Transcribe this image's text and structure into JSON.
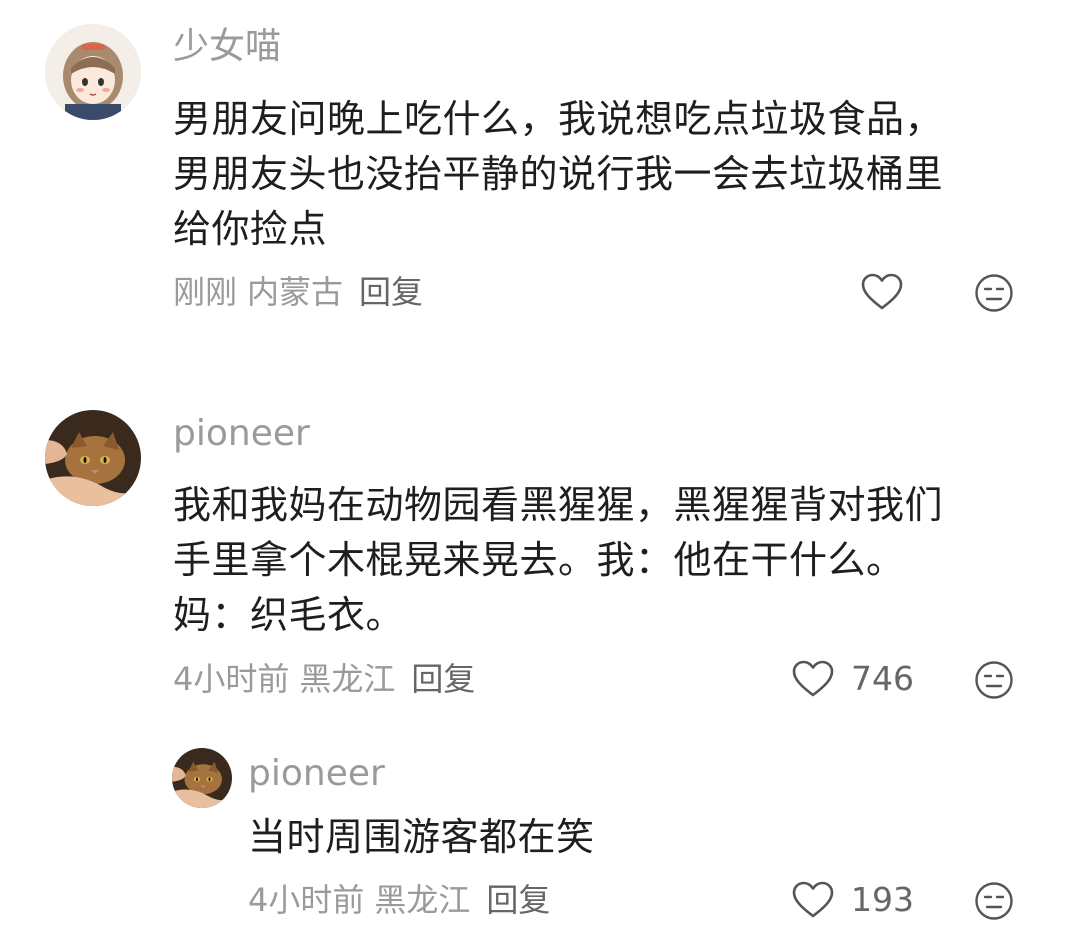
{
  "comments": [
    {
      "username": "少女喵",
      "text_lines": [
        "男朋友问晚上吃什么，我说想吃点垃圾食品，",
        "男朋友头也没抬平静的说行我一会去垃圾桶里",
        "给你捡点"
      ],
      "time": "刚刚",
      "location": "内蒙古",
      "reply_label": "回复",
      "likes": ""
    },
    {
      "username": "pioneer",
      "text_lines": [
        "我和我妈在动物园看黑猩猩，黑猩猩背对我们",
        "手里拿个木棍晃来晃去。我：他在干什么。",
        "妈：织毛衣。"
      ],
      "time": "4小时前",
      "location": "黑龙江",
      "reply_label": "回复",
      "likes": "746"
    },
    {
      "username": "pioneer",
      "text_lines": [
        "当时周围游客都在笑"
      ],
      "time": "4小时前",
      "location": "黑龙江",
      "reply_label": "回复",
      "likes": "193"
    }
  ],
  "icons": {
    "like": "heart-outline-icon",
    "dislike": "meh-face-icon"
  },
  "colors": {
    "meta_gray": "#9a9a9a",
    "icon_gray": "#555555"
  }
}
